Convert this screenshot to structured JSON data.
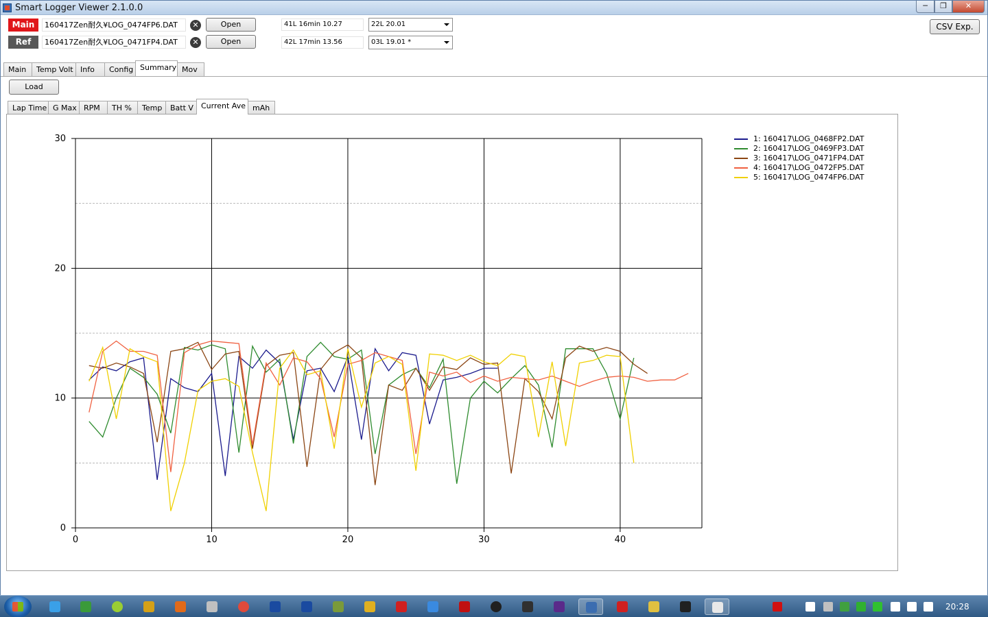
{
  "window": {
    "title": "Smart Logger Viewer 2.1.0.0",
    "controls": {
      "minimize": "─",
      "maximize": "❐",
      "close": "✕"
    }
  },
  "files": {
    "main": {
      "label": "Main",
      "path": "160417Zen耐久¥LOG_0474FP6.DAT",
      "clear": "✕",
      "open_label": "Open",
      "lap_info": "41L  16min  10.27",
      "lap_select": "22L  20.01"
    },
    "ref": {
      "label": "Ref",
      "path": "160417Zen耐久¥LOG_0471FP4.DAT",
      "clear": "✕",
      "open_label": "Open",
      "lap_info": "42L  17min  13.56",
      "lap_select": "03L  19.01 *"
    }
  },
  "csv_button": "CSV Exp.",
  "main_tabs": [
    {
      "label": "Main",
      "active": false
    },
    {
      "label": "Temp Volt",
      "active": false
    },
    {
      "label": "Info",
      "active": false
    },
    {
      "label": "Config",
      "active": false
    },
    {
      "label": "Summary",
      "active": true
    },
    {
      "label": "Mov",
      "active": false
    }
  ],
  "load_button": "Load",
  "summary_tabs": [
    {
      "label": "Lap Time",
      "active": false
    },
    {
      "label": "G Max",
      "active": false
    },
    {
      "label": "RPM",
      "active": false
    },
    {
      "label": "TH %",
      "active": false
    },
    {
      "label": "Temp",
      "active": false
    },
    {
      "label": "Batt V",
      "active": false
    },
    {
      "label": "Current Ave",
      "active": true
    },
    {
      "label": "mAh",
      "active": false
    }
  ],
  "chart_data": {
    "type": "line",
    "xlim": [
      0,
      46
    ],
    "ylim": [
      0,
      30
    ],
    "x_ticks": [
      0,
      10,
      20,
      30,
      40
    ],
    "y_ticks": [
      0,
      10,
      20,
      30
    ],
    "major_grid": true,
    "minor_y_grid": [
      5,
      15,
      25
    ],
    "legend_position": "top-right",
    "series": [
      {
        "name": "1: 160417\\LOG_0468FP2.DAT",
        "color": "#1a1a8c",
        "x": [
          1,
          2,
          3,
          4,
          5,
          6,
          7,
          8,
          9,
          10,
          11,
          12,
          13,
          14,
          15,
          16,
          17,
          18,
          19,
          20,
          21,
          22,
          23,
          24,
          25,
          26,
          27,
          28,
          29,
          30,
          31,
          32
        ],
        "y": [
          11.4,
          12.4,
          12.1,
          12.8,
          13.1,
          3.7,
          11.5,
          10.8,
          10.5,
          11.9,
          4.0,
          13.2,
          12.3,
          13.7,
          12.7,
          6.8,
          12.1,
          12.3,
          10.5,
          13.2,
          6.8,
          13.8,
          12.1,
          13.5,
          13.3,
          8.0,
          11.4,
          11.6,
          11.9,
          12.3,
          12.3,
          null
        ]
      },
      {
        "name": "2: 160417\\LOG_0469FP3.DAT",
        "color": "#2e8b2e",
        "x": [
          1,
          2,
          3,
          4,
          5,
          6,
          7,
          8,
          9,
          10,
          11,
          12,
          13,
          14,
          15,
          16,
          17,
          18,
          19,
          20,
          21,
          22,
          23,
          24,
          25,
          26,
          27,
          28,
          29,
          30,
          31,
          32,
          33,
          34,
          35,
          36,
          37,
          38,
          39,
          40,
          41
        ],
        "y": [
          8.2,
          7.0,
          10.0,
          12.3,
          11.6,
          10.3,
          7.3,
          13.9,
          13.7,
          14.1,
          13.8,
          5.8,
          14.0,
          12.0,
          13.0,
          6.5,
          13.2,
          14.3,
          13.2,
          13.0,
          13.7,
          5.7,
          11.0,
          11.8,
          12.3,
          10.8,
          13.0,
          3.4,
          10.0,
          11.3,
          10.4,
          11.5,
          12.5,
          11.0,
          6.2,
          13.8,
          13.8,
          13.8,
          11.9,
          8.4,
          13.1
        ]
      },
      {
        "name": "3: 160417\\LOG_0471FP4.DAT",
        "color": "#8b4513",
        "x": [
          1,
          2,
          3,
          4,
          5,
          6,
          7,
          8,
          9,
          10,
          11,
          12,
          13,
          14,
          15,
          16,
          17,
          18,
          19,
          20,
          21,
          22,
          23,
          24,
          25,
          26,
          27,
          28,
          29,
          30,
          31,
          32,
          33,
          34,
          35,
          36,
          37,
          38,
          39,
          40,
          41,
          42
        ],
        "y": [
          12.5,
          12.3,
          12.7,
          12.4,
          11.9,
          6.6,
          13.6,
          13.8,
          14.3,
          12.2,
          13.4,
          13.6,
          6.1,
          12.5,
          13.3,
          13.5,
          4.7,
          12.2,
          13.5,
          14.1,
          13.1,
          3.3,
          11.0,
          10.6,
          12.3,
          10.6,
          12.4,
          12.2,
          13.1,
          12.6,
          12.7,
          4.2,
          11.5,
          10.5,
          8.4,
          13.1,
          14.0,
          13.6,
          13.9,
          13.6,
          12.6,
          11.9
        ]
      },
      {
        "name": "4: 160417\\LOG_0472FP5.DAT",
        "color": "#f06040",
        "x": [
          1,
          2,
          3,
          4,
          5,
          6,
          7,
          8,
          9,
          10,
          11,
          12,
          13,
          14,
          15,
          16,
          17,
          18,
          19,
          20,
          21,
          22,
          23,
          24,
          25,
          26,
          27,
          28,
          29,
          30,
          31,
          32,
          33,
          34,
          35,
          36,
          37,
          38,
          39,
          40,
          41,
          42,
          43,
          44,
          45
        ],
        "y": [
          8.9,
          13.6,
          14.4,
          13.6,
          13.6,
          13.3,
          4.3,
          13.5,
          14.1,
          14.4,
          14.3,
          14.2,
          6.4,
          12.7,
          11.0,
          13.1,
          12.8,
          11.5,
          7.0,
          12.6,
          12.9,
          13.5,
          13.2,
          12.9,
          5.7,
          12.0,
          11.7,
          12.0,
          11.2,
          11.7,
          11.3,
          11.6,
          11.5,
          11.4,
          11.7,
          11.3,
          10.9,
          11.3,
          11.6,
          11.7,
          11.6,
          11.3,
          11.4,
          11.4,
          11.9
        ]
      },
      {
        "name": "5: 160417\\LOG_0474FP6.DAT",
        "color": "#f0d000",
        "x": [
          1,
          2,
          3,
          4,
          5,
          6,
          7,
          8,
          9,
          10,
          11,
          12,
          13,
          14,
          15,
          16,
          17,
          18,
          19,
          20,
          21,
          22,
          23,
          24,
          25,
          26,
          27,
          28,
          29,
          30,
          31,
          32,
          33,
          34,
          35,
          36,
          37,
          38,
          39,
          40,
          41
        ],
        "y": [
          11.3,
          13.9,
          8.4,
          13.8,
          13.2,
          12.8,
          1.3,
          5.0,
          10.6,
          11.3,
          11.5,
          10.9,
          5.8,
          1.3,
          12.3,
          13.7,
          11.8,
          12.1,
          6.1,
          13.8,
          9.3,
          12.7,
          13.2,
          12.6,
          4.4,
          13.4,
          13.3,
          12.9,
          13.3,
          12.8,
          12.5,
          13.4,
          13.2,
          7.0,
          12.8,
          6.3,
          12.7,
          12.9,
          13.3,
          13.2,
          5.0
        ]
      }
    ]
  },
  "taskbar": {
    "clock": "20:28",
    "icons": [
      {
        "name": "ie-icon",
        "color": "#3aa0e8"
      },
      {
        "name": "frog-icon",
        "color": "#3a9a3a"
      },
      {
        "name": "ball-icon",
        "color": "#9acd32"
      },
      {
        "name": "book-icon",
        "color": "#d4a017"
      },
      {
        "name": "firefox-icon",
        "color": "#e06a1a"
      },
      {
        "name": "speaker-app-icon",
        "color": "#c0c0c0"
      },
      {
        "name": "chrome-icon",
        "color": "#e04a3a"
      },
      {
        "name": "window-icon",
        "color": "#1a4aa0"
      },
      {
        "name": "window2-icon",
        "color": "#1a4aa0"
      },
      {
        "name": "grid-app-icon",
        "color": "#7a9a3a"
      },
      {
        "name": "lock-app-icon",
        "color": "#e0b020"
      },
      {
        "name": "t-app-icon",
        "color": "#d02020"
      },
      {
        "name": "p-app-icon",
        "color": "#3a8ae0"
      },
      {
        "name": "acrobat-icon",
        "color": "#c01010"
      },
      {
        "name": "bmw-icon",
        "color": "#202020"
      },
      {
        "name": "terminal-app-icon",
        "color": "#303030"
      },
      {
        "name": "pen-app-icon",
        "color": "#5a2a8a"
      },
      {
        "name": "logger-app-icon",
        "color": "#3b6db0"
      },
      {
        "name": "i2-app-icon",
        "color": "#d02020"
      },
      {
        "name": "folder-icon",
        "color": "#e0c040"
      },
      {
        "name": "cmd-icon",
        "color": "#202020"
      },
      {
        "name": "explorer-window-icon",
        "color": "#e8e8e8"
      }
    ],
    "tray": [
      {
        "name": "adobe-tray-icon",
        "color": "#d01010"
      },
      {
        "name": "windows-tray-icon",
        "color": "#ffffff"
      },
      {
        "name": "vm-tray-icon",
        "color": "#c0c0c0"
      },
      {
        "name": "green-tray-icon",
        "color": "#40a040"
      },
      {
        "name": "network-tray-icon",
        "color": "#30b030"
      },
      {
        "name": "check-tray-icon",
        "color": "#30c030"
      },
      {
        "name": "flag-tray-icon",
        "color": "#ffffff"
      },
      {
        "name": "monitor-tray-icon",
        "color": "#ffffff"
      },
      {
        "name": "volume-tray-icon",
        "color": "#ffffff"
      }
    ]
  }
}
